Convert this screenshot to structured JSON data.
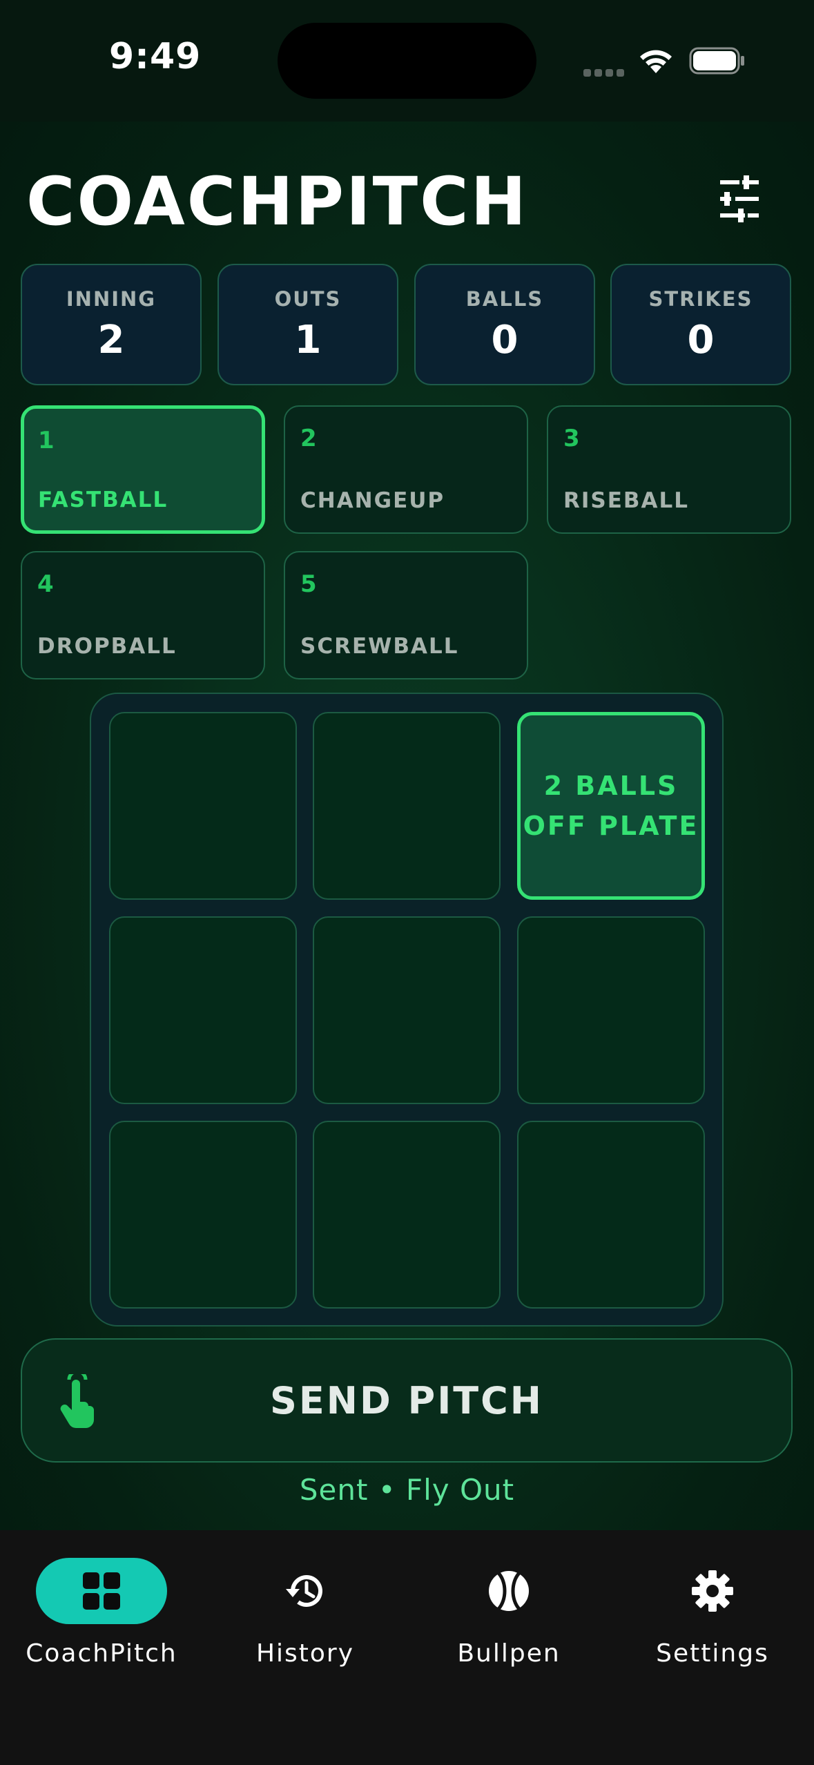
{
  "status_bar": {
    "time": "9:49"
  },
  "header": {
    "title": "COACHPITCH",
    "filter_icon": "sliders-icon"
  },
  "stats": [
    {
      "label": "INNING",
      "value": "2"
    },
    {
      "label": "OUTS",
      "value": "1"
    },
    {
      "label": "BALLS",
      "value": "0"
    },
    {
      "label": "STRIKES",
      "value": "0"
    }
  ],
  "pitches": [
    {
      "number": "1",
      "name": "FASTBALL",
      "selected": true
    },
    {
      "number": "2",
      "name": "CHANGEUP",
      "selected": false
    },
    {
      "number": "3",
      "name": "RISEBALL",
      "selected": false
    },
    {
      "number": "4",
      "name": "DROPBALL",
      "selected": false
    },
    {
      "number": "5",
      "name": "SCREWBALL",
      "selected": false
    }
  ],
  "zones": {
    "selected_label": "2 BALLS\nOFF PLATE"
  },
  "send": {
    "label": "SEND PITCH",
    "icon": "tap-hand-icon",
    "status": "Sent • Fly Out"
  },
  "tabs": [
    {
      "label": "CoachPitch",
      "icon": "grid-icon",
      "active": true
    },
    {
      "label": "History",
      "icon": "history-icon",
      "active": false
    },
    {
      "label": "Bullpen",
      "icon": "softball-icon",
      "active": false
    },
    {
      "label": "Settings",
      "icon": "gear-icon",
      "active": false
    }
  ],
  "colors": {
    "accent": "#35e274",
    "tab_active": "#14c9b3",
    "background": "#052012"
  }
}
